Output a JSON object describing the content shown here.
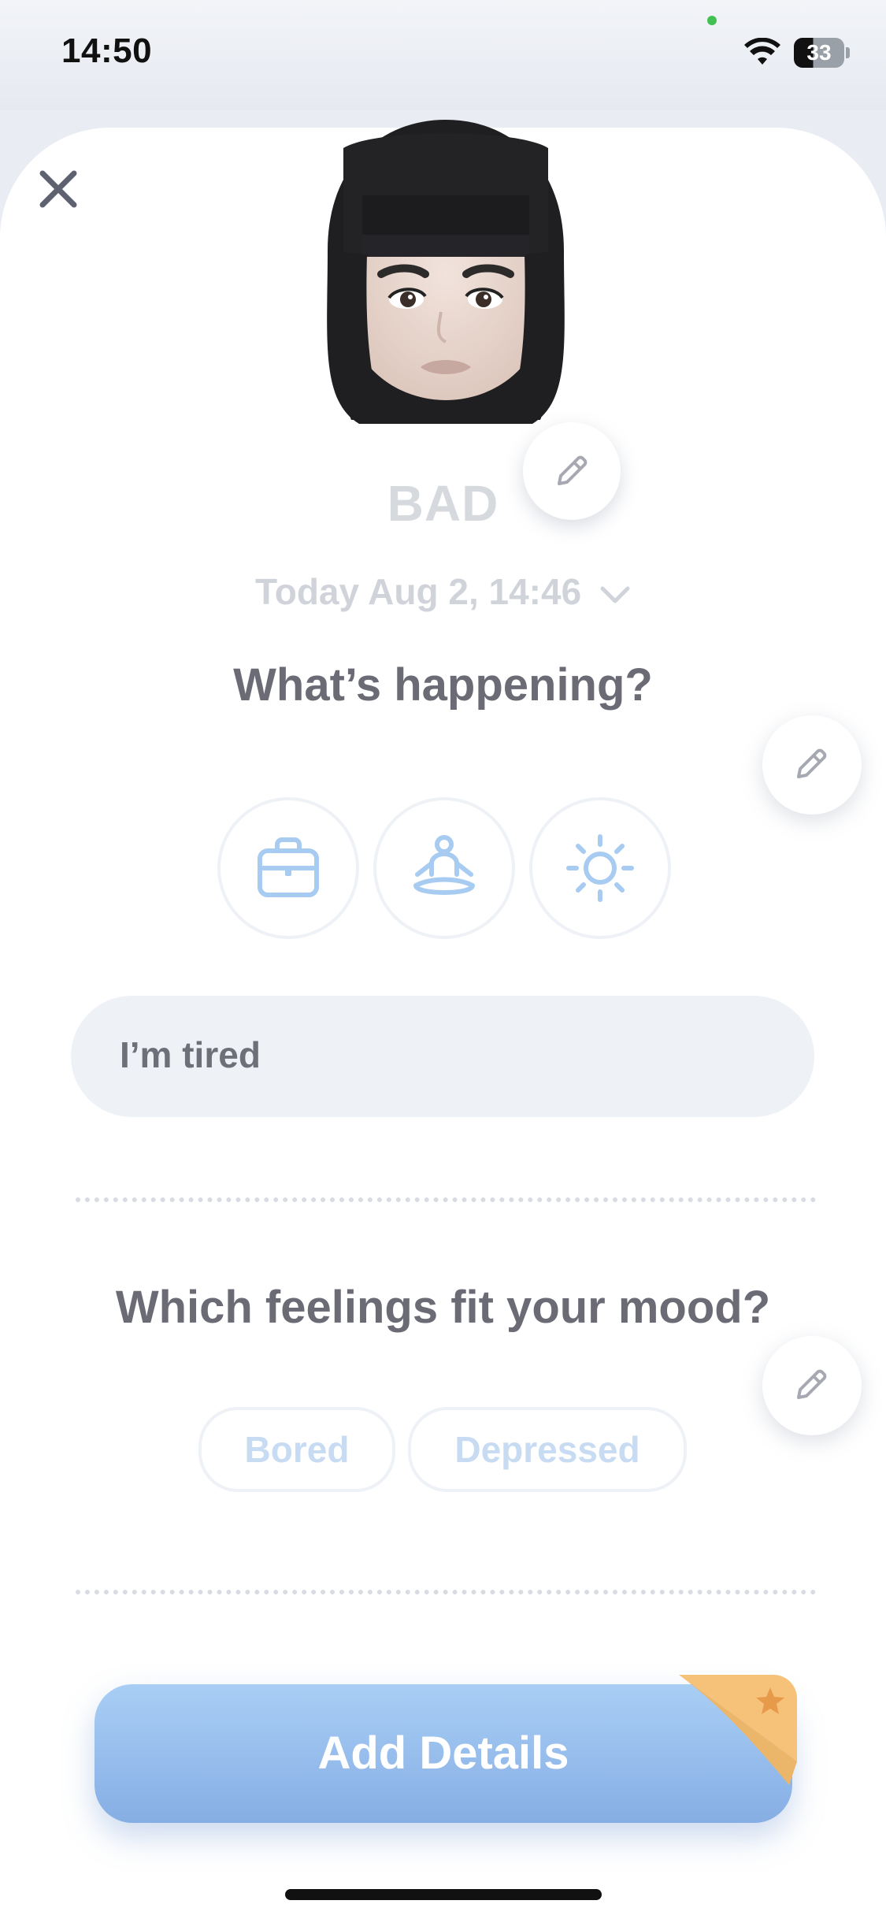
{
  "status_bar": {
    "time": "14:50",
    "battery_level": "33",
    "icons": [
      "wifi-icon",
      "battery-icon"
    ]
  },
  "mood": {
    "label": "BAD",
    "date": "Today Aug 2, 14:46"
  },
  "happening": {
    "title": "What’s happening?",
    "activities": [
      "briefcase-icon",
      "meditation-icon",
      "sun-icon"
    ],
    "note_value": "I’m tired"
  },
  "feelings": {
    "title": "Which feelings fit your mood?",
    "chips": [
      "Bored",
      "Depressed"
    ]
  },
  "actions": {
    "add_details": "Add Details"
  },
  "colors": {
    "accent_blue": "#8fb4e8",
    "chip_text": "#c7dbf2",
    "title_gray": "#6b6b76",
    "premium_orange": "#f4b564"
  }
}
